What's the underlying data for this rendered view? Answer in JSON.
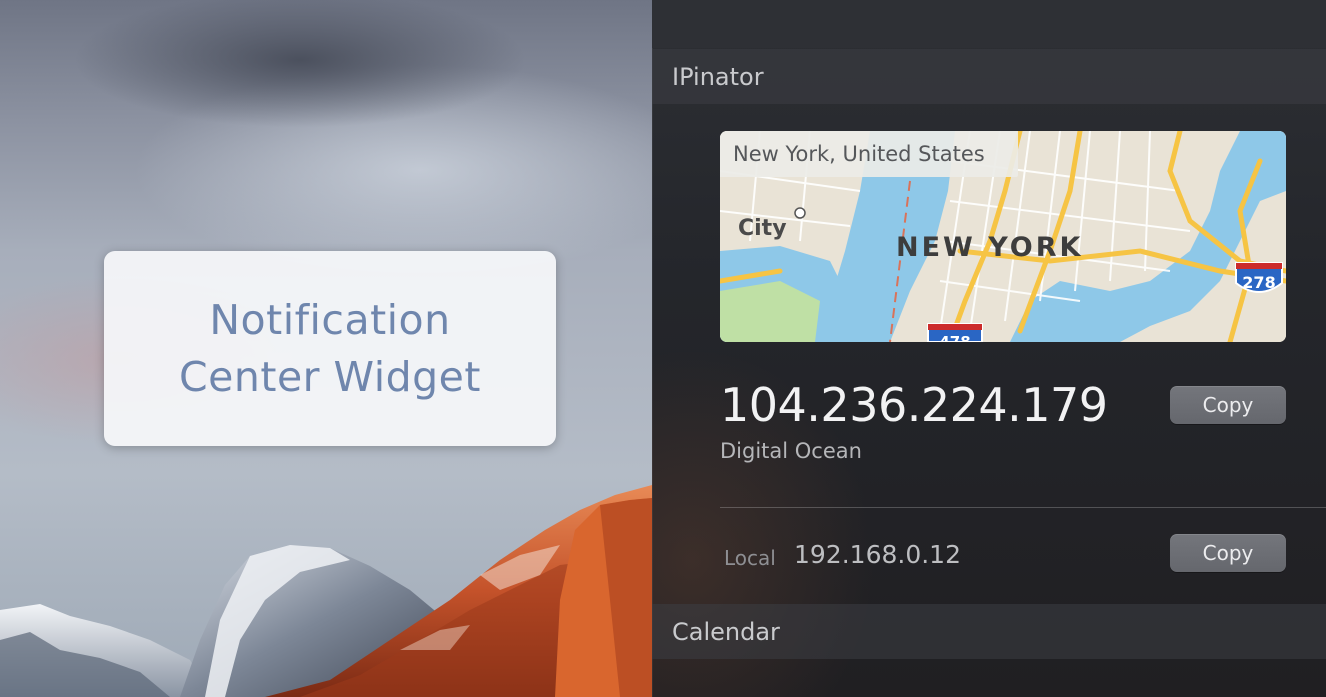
{
  "promo": {
    "line1": "Notification",
    "line2": "Center Widget"
  },
  "widget": {
    "title": "IPinator",
    "location": "New York, United States",
    "map": {
      "city_label": "New York",
      "neighbor_label": "City",
      "shield_top": "278",
      "shield_bottom": "478"
    },
    "public_ip": "104.236.224.179",
    "isp": "Digital Ocean",
    "copy_label": "Copy",
    "local_label": "Local",
    "local_ip": "192.168.0.12"
  },
  "next_section": {
    "title": "Calendar"
  },
  "colors": {
    "promo_text": "#6f86ad",
    "map_water": "#8ec8e8",
    "map_land": "#e9e3d6",
    "map_park": "#bfe0a5",
    "map_road": "#f6c444",
    "button": "#6c6e74"
  }
}
